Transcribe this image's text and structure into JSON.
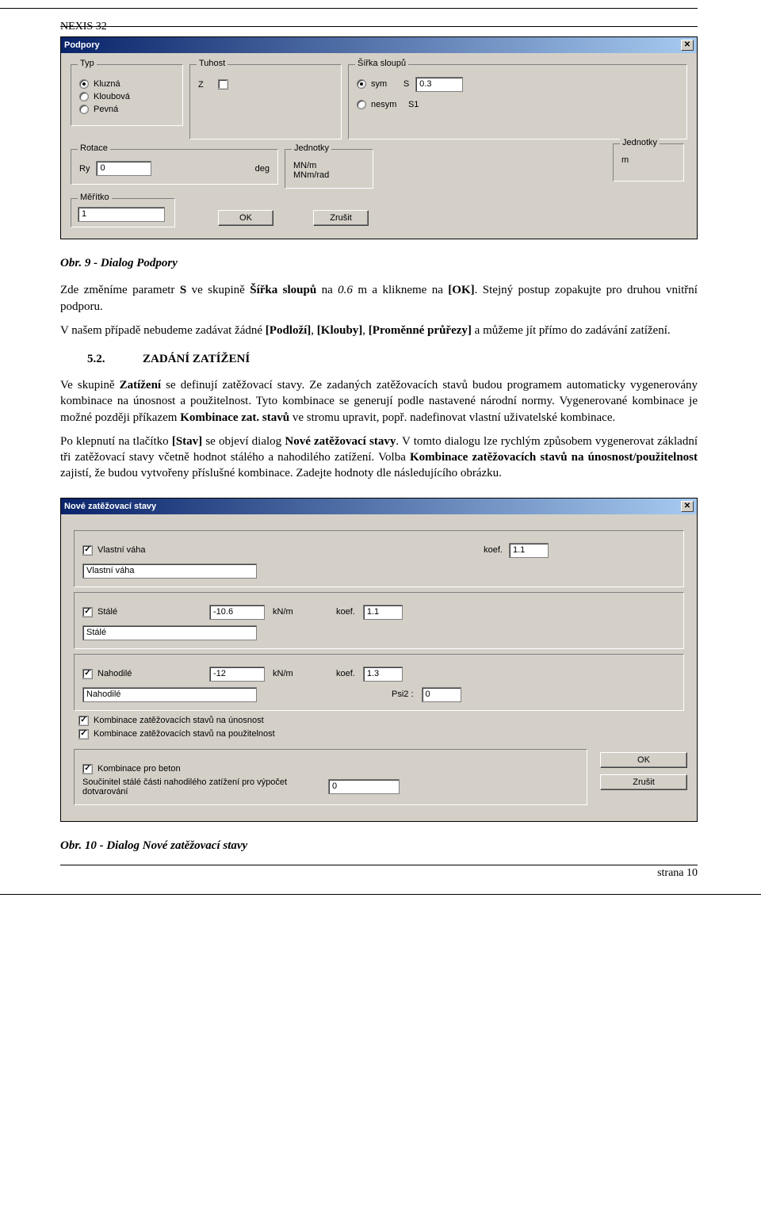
{
  "header": {
    "app": "NEXIS 32"
  },
  "dialog1": {
    "title": "Podpory",
    "typ": {
      "legend": "Typ",
      "opt1": "Kluzná",
      "opt2": "Kloubová",
      "opt3": "Pevná"
    },
    "tuhost": {
      "legend": "Tuhost",
      "z_label": "Z"
    },
    "sirka": {
      "legend": "Šířka sloupů",
      "sym": "sym",
      "nesym": "nesym",
      "s_label": "S",
      "s1_label": "S1",
      "s_value": "0.3"
    },
    "jedn_sirka": {
      "legend": "Jednotky",
      "unit": "m"
    },
    "rotace": {
      "legend": "Rotace",
      "ry_label": "Ry",
      "ry_value": "0",
      "unit": "deg"
    },
    "jedn_rot": {
      "legend": "Jednotky",
      "l1": "MN/m",
      "l2": "MNm/rad"
    },
    "meritko": {
      "legend": "Měřítko",
      "value": "1"
    },
    "ok": "OK",
    "cancel": "Zrušit"
  },
  "text": {
    "cap1": "Obr. 9 - Dialog Podpory",
    "p1a": "Zde změníme parametr ",
    "p1b": "S",
    "p1c": " ve skupině ",
    "p1d": "Šířka sloupů",
    "p1e": " na ",
    "p1f": "0.6",
    "p1g": " m a klikneme na ",
    "p1h": "[OK]",
    "p1i": ". Stejný postup zopakujte pro druhou vnitřní podporu.",
    "p2a": "V našem případě nebudeme zadávat žádné ",
    "p2b": "[Podloží]",
    "p2c": ", ",
    "p2d": "[Klouby]",
    "p2e": ", ",
    "p2f": "[Proměnné průřezy]",
    "p2g": " a můžeme jít přímo do zadávání zatížení.",
    "secnum": "5.2.",
    "sectitle": "ZADÁNÍ ZATÍŽENÍ",
    "p3a": "Ve skupině ",
    "p3b": "Zatížení",
    "p3c": " se definují zatěžovací stavy. Ze zadaných zatěžovacích stavů budou programem automaticky vygenerovány kombinace na únosnost a použitelnost. Tyto kombinace se generují podle nastavené národní normy. Vygenerované kombinace je možné později příkazem ",
    "p3d": "Kombinace zat. stavů",
    "p3e": " ve stromu upravit, popř. nadefinovat vlastní uživatelské kombinace.",
    "p4a": "Po klepnutí na tlačítko ",
    "p4b": "[Stav]",
    "p4c": " se objeví dialog ",
    "p4d": "Nové zatěžovací stavy",
    "p4e": ". V tomto dialogu lze rychlým způsobem vygenerovat základní tři zatěžovací stavy včetně hodnot stálého a nahodilého zatížení. Volba ",
    "p4f": "Kombinace zatěžovacích stavů na únosnost/použitelnost",
    "p4g": " zajistí, že budou vytvořeny příslušné kombinace. Zadejte hodnoty dle následujícího obrázku.",
    "cap2": "Obr. 10 - Dialog Nové zatěžovací stavy"
  },
  "dialog2": {
    "title": "Nové zatěžovací stavy",
    "vlastni": {
      "chk": "Vlastní váha",
      "name": "Vlastní váha",
      "koef_lbl": "koef.",
      "koef": "1.1"
    },
    "stale": {
      "chk": "Stálé",
      "name": "Stálé",
      "val": "-10.6",
      "unit": "kN/m",
      "koef_lbl": "koef.",
      "koef": "1.1"
    },
    "nahodile": {
      "chk": "Nahodilé",
      "name": "Nahodilé",
      "val": "-12",
      "unit": "kN/m",
      "koef_lbl": "koef.",
      "koef": "1.3",
      "psi_lbl": "Psi2 :",
      "psi": "0"
    },
    "komb1": "Kombinace zatěžovacích stavů na únosnost",
    "komb2": "Kombinace zatěžovacích stavů na použitelnost",
    "beton_chk": "Kombinace pro beton",
    "beton_txt": "Součinitel stálé části nahodilého zatížení pro výpočet dotvarování",
    "beton_val": "0",
    "ok": "OK",
    "cancel": "Zrušit"
  },
  "footer": {
    "page": "strana 10"
  }
}
